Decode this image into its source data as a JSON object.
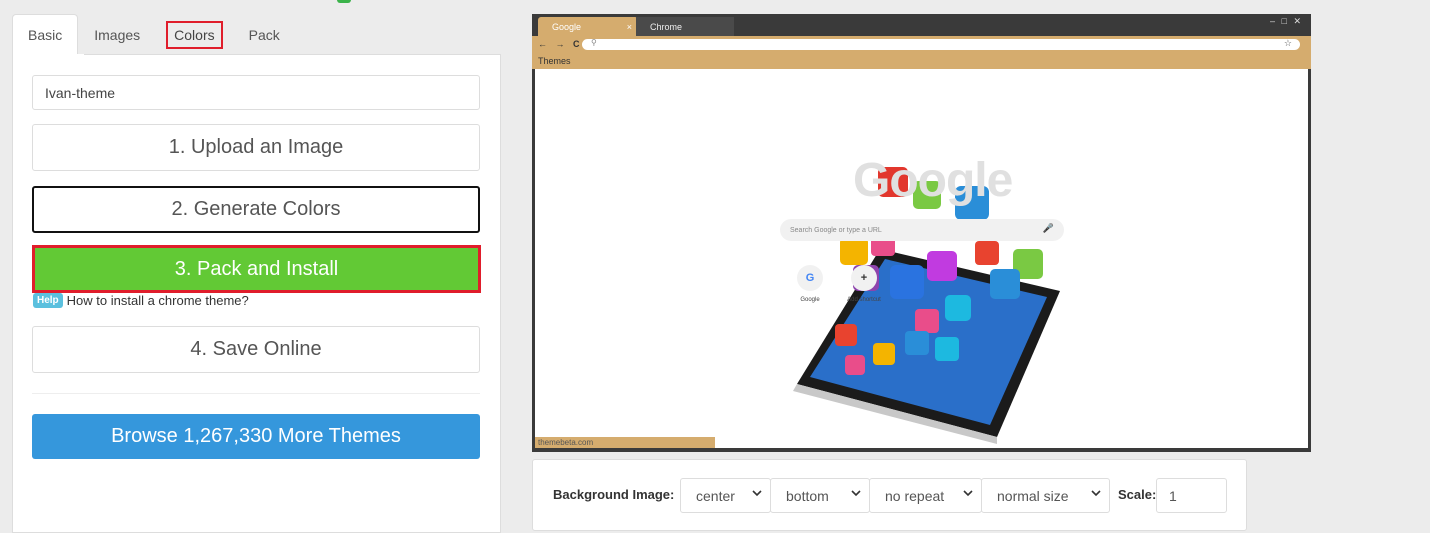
{
  "tabs": [
    {
      "label": "Basic",
      "active": true
    },
    {
      "label": "Images",
      "active": false
    },
    {
      "label": "Colors",
      "active": false,
      "highlighted": true
    },
    {
      "label": "Pack",
      "active": false
    }
  ],
  "basic": {
    "theme_name": "Ivan-theme",
    "upload_label": "1. Upload an Image",
    "generate_label": "2. Generate Colors",
    "pack_label": "3. Pack and Install",
    "help_badge": "Help",
    "help_link": "How to install a chrome theme?",
    "save_label": "4. Save Online",
    "browse_label": "Browse 1,267,330 More Themes"
  },
  "preview": {
    "tab_active": "Google",
    "tab_inactive": "Chrome",
    "bookmark": "Themes",
    "status_text": "themebeta.com",
    "logo_text": "Google",
    "search_placeholder": "Search Google or type a URL",
    "shortcut_google": "Google",
    "shortcut_add": "Add shortcut",
    "shortcut_google_glyph": "G",
    "shortcut_add_glyph": "+",
    "window_controls": "– □ ✕",
    "nav_glyphs": "← → C",
    "omnibox_glyph": "⚲",
    "star_glyph": "☆",
    "close_glyph": "×",
    "mic_glyph": "🎤"
  },
  "bg_controls": {
    "label": "Background Image:",
    "position_x": "center",
    "position_y": "bottom",
    "repeat": "no repeat",
    "size": "normal size",
    "scale_label": "Scale:",
    "scale_value": "1"
  },
  "colors": {
    "accent_green": "#62c935",
    "browse_blue": "#3597dc",
    "highlight_red": "#e01d2b",
    "frame_tan": "#d5ac6e"
  }
}
